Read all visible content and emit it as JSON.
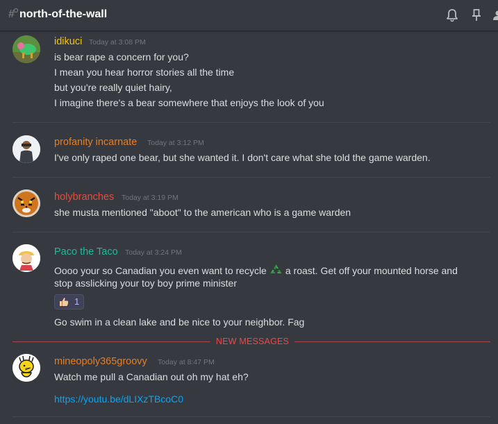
{
  "header": {
    "channel_name": "north-of-the-wall",
    "icons": [
      "channel-hash-icon",
      "bell-icon",
      "pin-icon",
      "members-icon"
    ]
  },
  "messages": [
    {
      "username": "idikuci",
      "username_color": "#f1c40f",
      "timestamp": "Today at 3:08 PM",
      "lines": [
        "is bear rape a concern for you?",
        "I mean you hear horror stories all the time",
        "but you're really quiet hairy,",
        "I imagine there's a bear somewhere that enjoys the look of you"
      ]
    },
    {
      "username": "profanity incarnate",
      "username_color": "#e67e22",
      "timestamp": "Today at 3:12 PM",
      "lines": [
        "I've only raped one bear, but she wanted it. I don't care what she told the game warden."
      ]
    },
    {
      "username": "holybranches",
      "username_color": "#e74c3c",
      "timestamp": "Today at 3:19 PM",
      "lines": [
        "she musta mentioned \"aboot\" to the american who is a game warden"
      ]
    },
    {
      "username": "Paco the Taco",
      "username_color": "#1abc9c",
      "timestamp": "Today at 3:24 PM",
      "line1_before": "Oooo your so Canadian you even want to recycle",
      "line1_after": "a roast.   Get off your mounted horse and",
      "line2": "stop asslicking your toy boy prime minister",
      "reaction": {
        "emoji": "thumbs-up-icon",
        "count": "1"
      },
      "line3": "Go swim in a clean lake and be nice to your neighbor.  Fag"
    },
    {
      "username": "mineopoly365groovy",
      "username_color": "#e67e22",
      "timestamp": "Today at 8:47 PM",
      "lines": [
        "Watch me pull a Canadian out oh my hat eh?"
      ],
      "link": "https://youtu.be/dLIXzTBcoC0"
    }
  ],
  "new_messages_label": "NEW MESSAGES"
}
